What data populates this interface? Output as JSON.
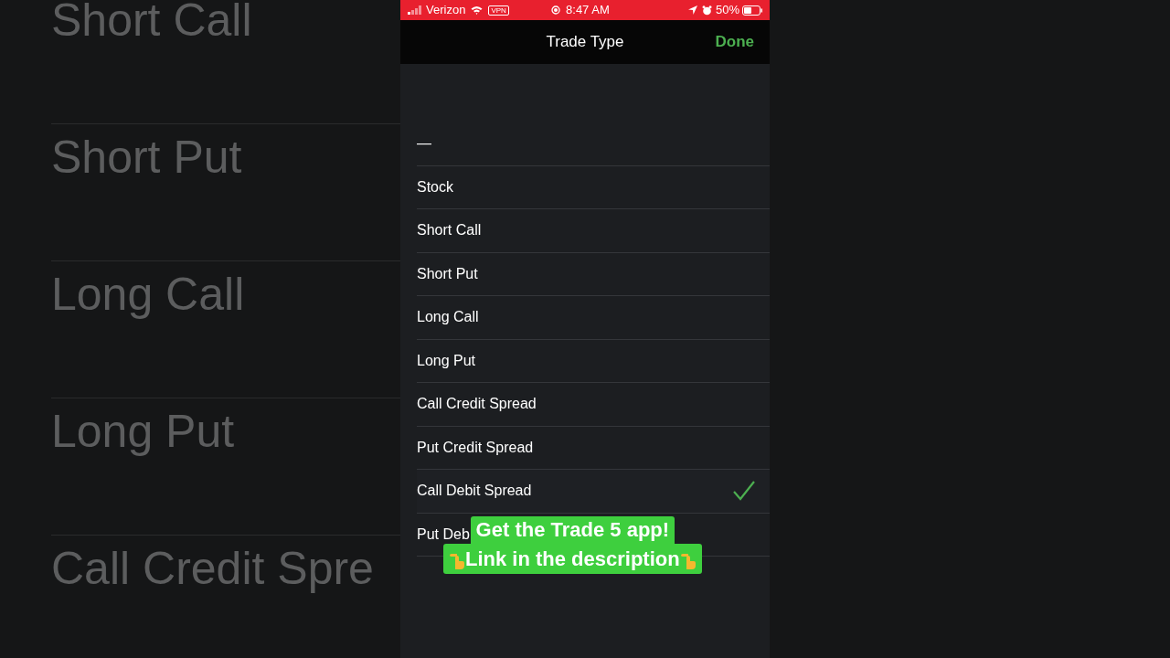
{
  "background_list": [
    "Short Call",
    "Short Put",
    "Long Call",
    "Long Put",
    "Call Credit Spre"
  ],
  "status_bar": {
    "carrier": "Verizon",
    "vpn": "VPN",
    "time": "8:47 AM",
    "battery": "50%"
  },
  "nav_bar": {
    "title": "Trade Type",
    "done": "Done"
  },
  "options": [
    {
      "label": "—",
      "selected": false
    },
    {
      "label": "Stock",
      "selected": false
    },
    {
      "label": "Short Call",
      "selected": false
    },
    {
      "label": "Short Put",
      "selected": false
    },
    {
      "label": "Long Call",
      "selected": false
    },
    {
      "label": "Long Put",
      "selected": false
    },
    {
      "label": "Call Credit Spread",
      "selected": false
    },
    {
      "label": "Put Credit Spread",
      "selected": false
    },
    {
      "label": "Call Debit Spread",
      "selected": true
    },
    {
      "label": "Put Deb",
      "selected": false
    }
  ],
  "caption": [
    "Get the Trade 5 app!",
    "Link in the description"
  ]
}
